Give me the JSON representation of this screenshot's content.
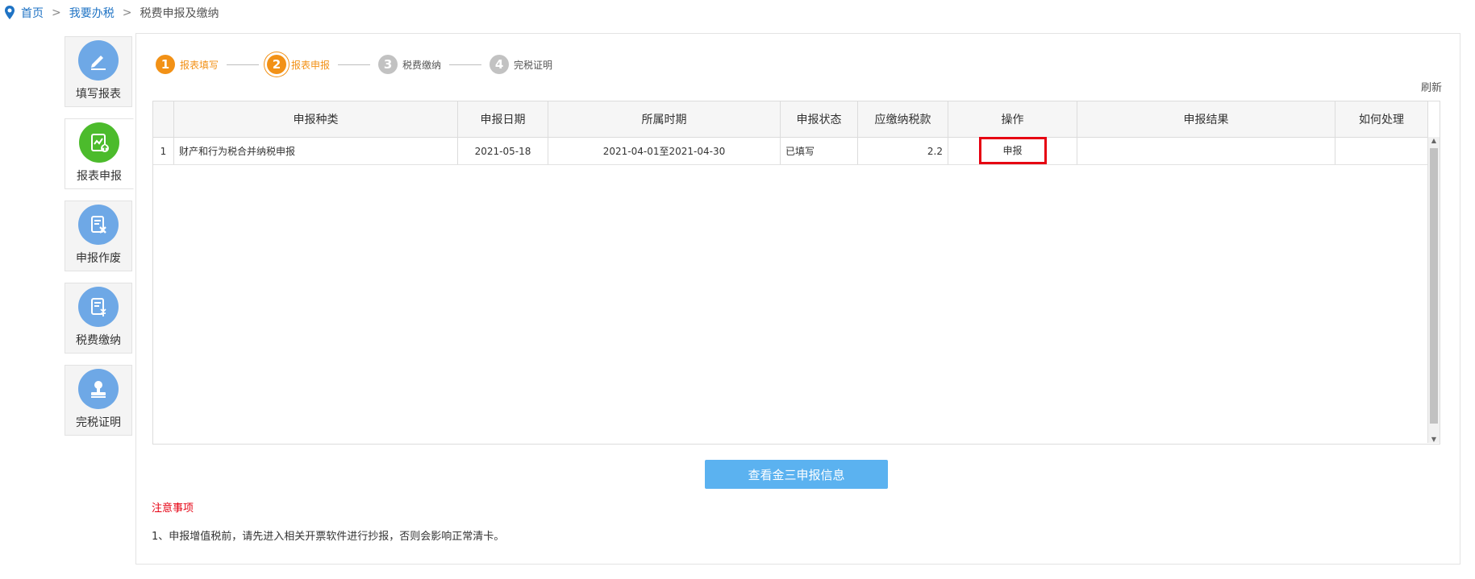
{
  "breadcrumb": {
    "home": "首页",
    "section": "我要办税",
    "current": "税费申报及缴纳",
    "separator": ">"
  },
  "sidebar": {
    "items": [
      {
        "label": "填写报表",
        "icon": "pencil-icon",
        "color": "#6ea8e6",
        "active": false
      },
      {
        "label": "报表申报",
        "icon": "report-upload-icon",
        "color": "#4cbb2c",
        "active": true
      },
      {
        "label": "申报作废",
        "icon": "document-cancel-icon",
        "color": "#6ea8e6",
        "active": false
      },
      {
        "label": "税费缴纳",
        "icon": "tax-payment-icon",
        "color": "#6ea8e6",
        "active": false
      },
      {
        "label": "完税证明",
        "icon": "stamp-icon",
        "color": "#6ea8e6",
        "active": false
      }
    ]
  },
  "steps": [
    {
      "num": "1",
      "label": "报表填写",
      "state": "done"
    },
    {
      "num": "2",
      "label": "报表申报",
      "state": "current"
    },
    {
      "num": "3",
      "label": "税费缴纳",
      "state": "todo"
    },
    {
      "num": "4",
      "label": "完税证明",
      "state": "todo"
    }
  ],
  "refresh_label": "刷新",
  "table": {
    "columns": [
      "申报种类",
      "申报日期",
      "所属时期",
      "申报状态",
      "应缴纳税款",
      "操作",
      "申报结果",
      "如何处理"
    ],
    "rows": [
      {
        "index": "1",
        "type": "财产和行为税合并纳税申报",
        "date": "2021-05-18",
        "period": "2021-04-01至2021-04-30",
        "status": "已填写",
        "amount": "2.2",
        "action": "申报",
        "result": "",
        "handle": ""
      }
    ]
  },
  "view_button": "查看金三申报信息",
  "notes": {
    "title": "注意事项",
    "items": [
      "1、申报增值税前，请先进入相关开票软件进行抄报，否则会影响正常清卡。"
    ]
  },
  "colors": {
    "link": "#1f73c4",
    "accent_orange": "#f29116",
    "highlight_red": "#e60012",
    "button_blue": "#5bb2f0"
  }
}
